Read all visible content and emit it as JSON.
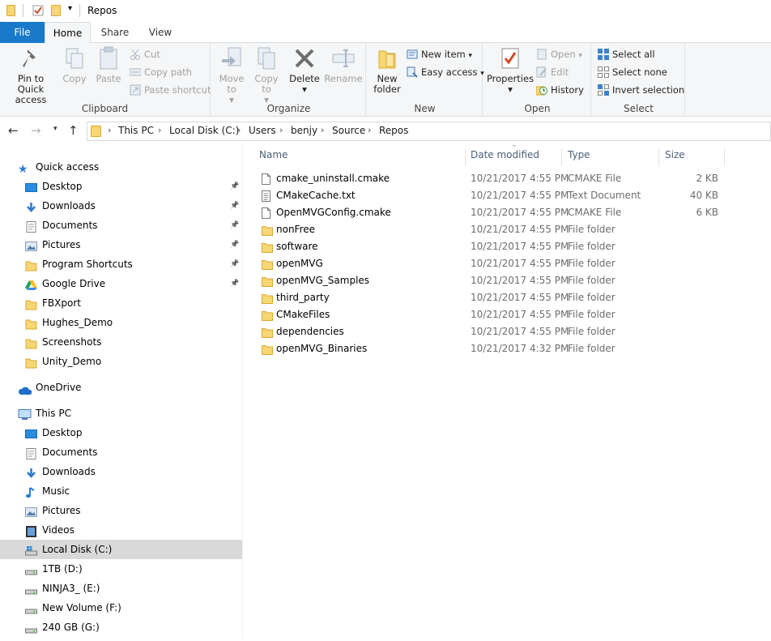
{
  "window": {
    "title": "Repos"
  },
  "ribbon": {
    "tabs": [
      "File",
      "Home",
      "Share",
      "View"
    ],
    "clipboard": {
      "label": "Clipboard",
      "pin_to_quick_access": "Pin to Quick access",
      "copy": "Copy",
      "paste": "Paste",
      "cut": "Cut",
      "copy_path": "Copy path",
      "paste_shortcut": "Paste shortcut"
    },
    "organize": {
      "label": "Organize",
      "move_to": "Move to",
      "copy_to": "Copy to",
      "delete": "Delete",
      "rename": "Rename"
    },
    "new": {
      "label": "New",
      "new_folder": "New folder",
      "new_item": "New item",
      "easy_access": "Easy access"
    },
    "open": {
      "label": "Open",
      "properties": "Properties",
      "open": "Open",
      "edit": "Edit",
      "history": "History"
    },
    "select": {
      "label": "Select",
      "select_all": "Select all",
      "select_none": "Select none",
      "invert_selection": "Invert selection"
    }
  },
  "address": {
    "crumbs": [
      "This PC",
      "Local Disk (C:)",
      "Users",
      "benjy",
      "Source",
      "Repos"
    ]
  },
  "nav": {
    "quick_access": "Quick access",
    "quick_items": [
      "Desktop",
      "Downloads",
      "Documents",
      "Pictures",
      "Program Shortcuts",
      "Google Drive",
      "FBXport",
      "Hughes_Demo",
      "Screenshots",
      "Unity_Demo"
    ],
    "onedrive": "OneDrive",
    "this_pc": "This PC",
    "pc_items": [
      "Desktop",
      "Documents",
      "Downloads",
      "Music",
      "Pictures",
      "Videos",
      "Local Disk (C:)",
      "1TB (D:)",
      "NINJA3_ (E:)",
      "New Volume (F:)",
      "240 GB (G:)"
    ]
  },
  "columns": {
    "name": "Name",
    "date": "Date modified",
    "type": "Type",
    "size": "Size"
  },
  "files": [
    {
      "name": "cmake_uninstall.cmake",
      "date": "10/21/2017 4:55 PM",
      "type": "CMAKE File",
      "size": "2 KB",
      "kind": "file"
    },
    {
      "name": "CMakeCache.txt",
      "date": "10/21/2017 4:55 PM",
      "type": "Text Document",
      "size": "40 KB",
      "kind": "text"
    },
    {
      "name": "OpenMVGConfig.cmake",
      "date": "10/21/2017 4:55 PM",
      "type": "CMAKE File",
      "size": "6 KB",
      "kind": "file"
    },
    {
      "name": "nonFree",
      "date": "10/21/2017 4:55 PM",
      "type": "File folder",
      "size": "",
      "kind": "folder"
    },
    {
      "name": "software",
      "date": "10/21/2017 4:55 PM",
      "type": "File folder",
      "size": "",
      "kind": "folder"
    },
    {
      "name": "openMVG",
      "date": "10/21/2017 4:55 PM",
      "type": "File folder",
      "size": "",
      "kind": "folder"
    },
    {
      "name": "openMVG_Samples",
      "date": "10/21/2017 4:55 PM",
      "type": "File folder",
      "size": "",
      "kind": "folder"
    },
    {
      "name": "third_party",
      "date": "10/21/2017 4:55 PM",
      "type": "File folder",
      "size": "",
      "kind": "folder"
    },
    {
      "name": "CMakeFiles",
      "date": "10/21/2017 4:55 PM",
      "type": "File folder",
      "size": "",
      "kind": "folder"
    },
    {
      "name": "dependencies",
      "date": "10/21/2017 4:55 PM",
      "type": "File folder",
      "size": "",
      "kind": "folder"
    },
    {
      "name": "openMVG_Binaries",
      "date": "10/21/2017 4:32 PM",
      "type": "File folder",
      "size": "",
      "kind": "folder"
    }
  ],
  "colors": {
    "accent": "#1979ca",
    "folder": "#f7d674",
    "selected_nav": "#d9d9d9"
  }
}
